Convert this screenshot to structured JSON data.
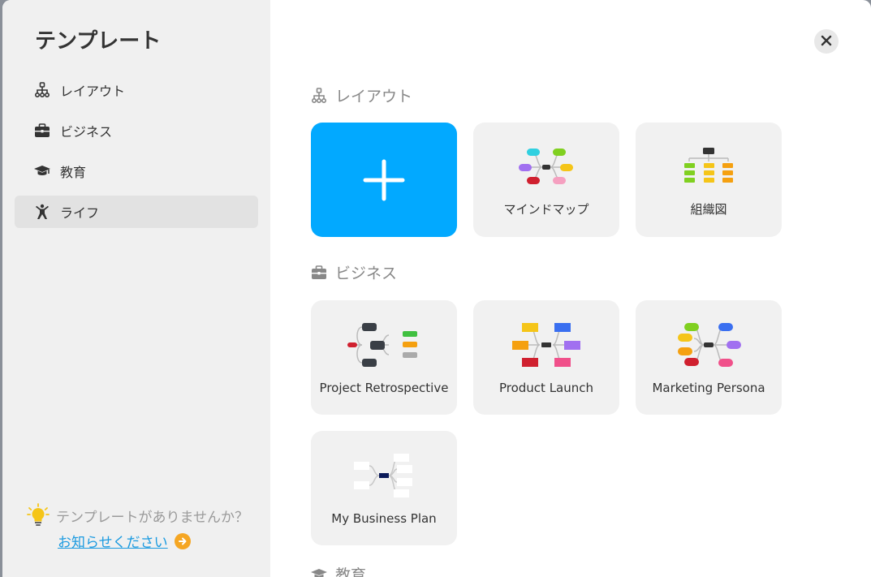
{
  "sidebar": {
    "title": "テンプレート",
    "items": [
      {
        "label": "レイアウト",
        "icon": "sitemap-icon"
      },
      {
        "label": "ビジネス",
        "icon": "briefcase-icon"
      },
      {
        "label": "教育",
        "icon": "graduation-cap-icon"
      },
      {
        "label": "ライフ",
        "icon": "person-icon",
        "active": true
      }
    ],
    "footer": {
      "question": "テンプレートがありませんか？",
      "link": "お知らせください"
    }
  },
  "sections": [
    {
      "title": "レイアウト",
      "cards": [
        {
          "label": "",
          "type": "blank"
        },
        {
          "label": "マインドマップ"
        },
        {
          "label": "組織図"
        }
      ]
    },
    {
      "title": "ビジネス",
      "cards": [
        {
          "label": "Project Retrospective"
        },
        {
          "label": "Product Launch"
        },
        {
          "label": "Marketing Persona"
        },
        {
          "label": "My Business Plan"
        }
      ]
    },
    {
      "title": "教育"
    }
  ],
  "colors": {
    "accent": "#02a9ff",
    "sidebar_bg": "#f0f0f0",
    "card_bg": "#f1f1f1",
    "link": "#1a9ae0",
    "arrow": "#f5a623"
  }
}
